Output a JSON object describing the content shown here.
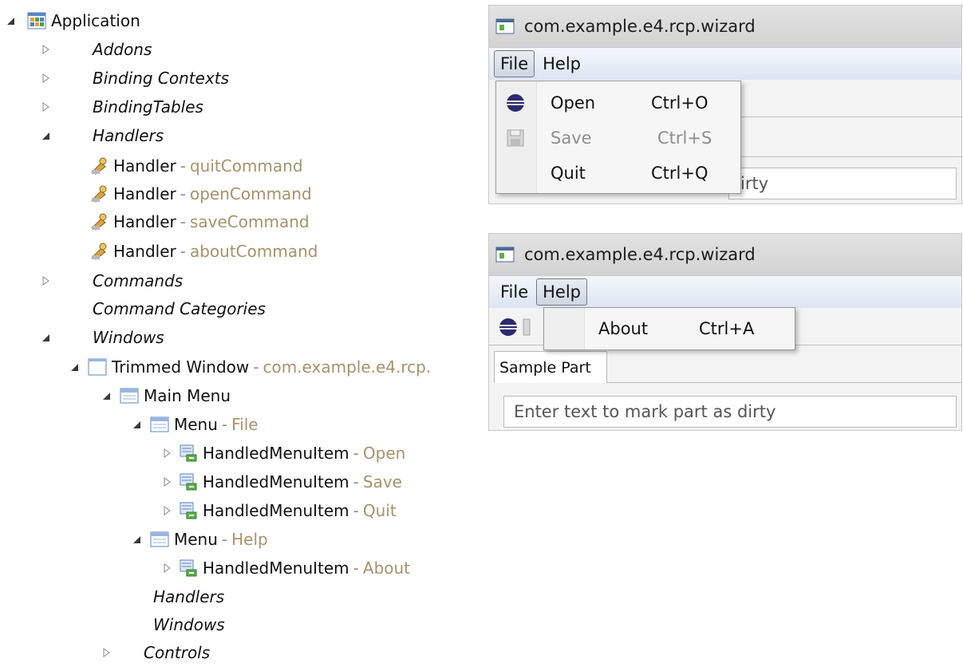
{
  "tree": {
    "separator": "-",
    "application": "Application",
    "addons": "Addons",
    "binding_contexts": "Binding Contexts",
    "binding_tables": "BindingTables",
    "handlers": "Handlers",
    "handler_items": [
      {
        "label": "Handler",
        "value": "quitCommand"
      },
      {
        "label": "Handler",
        "value": "openCommand"
      },
      {
        "label": "Handler",
        "value": "saveCommand"
      },
      {
        "label": "Handler",
        "value": "aboutCommand"
      }
    ],
    "commands": "Commands",
    "command_categories": "Command Categories",
    "windows": "Windows",
    "trimmed_window": {
      "label": "Trimmed Window",
      "value": "com.example.e4.rcp."
    },
    "main_menu": "Main Menu",
    "menu_file": {
      "label": "Menu",
      "value": "File"
    },
    "file_items": [
      {
        "label": "HandledMenuItem",
        "value": "Open"
      },
      {
        "label": "HandledMenuItem",
        "value": "Save"
      },
      {
        "label": "HandledMenuItem",
        "value": "Quit"
      }
    ],
    "menu_help": {
      "label": "Menu",
      "value": "Help"
    },
    "help_items": [
      {
        "label": "HandledMenuItem",
        "value": "About"
      }
    ],
    "window_handlers": "Handlers",
    "window_windows": "Windows",
    "controls": "Controls"
  },
  "window1": {
    "title": "com.example.e4.rcp.wizard",
    "menus": {
      "file": "File",
      "help": "Help"
    },
    "dropdown": [
      {
        "label": "Open",
        "accel": "Ctrl+O",
        "icon": "eclipse-icon",
        "enabled": true
      },
      {
        "label": "Save",
        "accel": "Ctrl+S",
        "icon": "save-icon",
        "enabled": false
      },
      {
        "label": "Quit",
        "accel": "Ctrl+Q",
        "icon": "",
        "enabled": true
      }
    ],
    "field_text_partial": "irty"
  },
  "window2": {
    "title": "com.example.e4.rcp.wizard",
    "menus": {
      "file": "File",
      "help": "Help"
    },
    "dropdown": [
      {
        "label": "About",
        "accel": "Ctrl+A"
      }
    ],
    "tab_label": "Sample Part",
    "field_text": "Enter text to mark part as dirty"
  },
  "colors": {
    "value_text": "#a8916a",
    "menubar": "#dde5f3"
  }
}
